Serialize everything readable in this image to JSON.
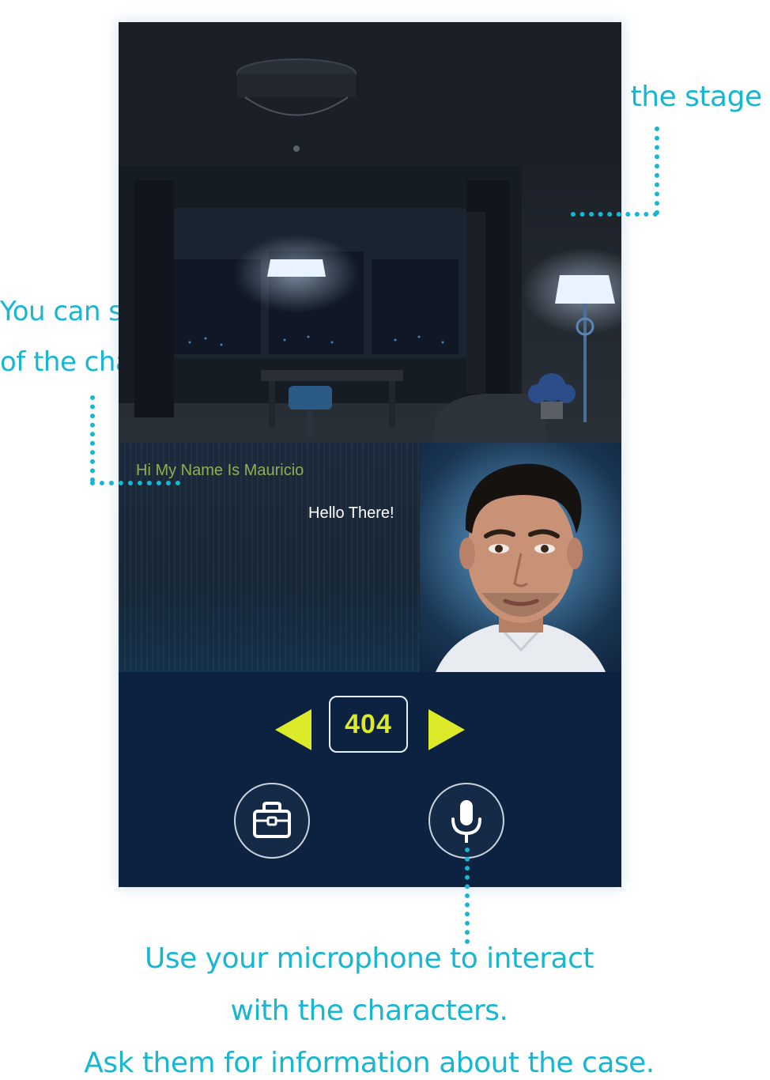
{
  "annotations": {
    "stage": "Pay attention to the stage",
    "answers_line1": "You can see here the answers",
    "answers_line2": "of the characters",
    "mic_line1": "Use your microphone to interact",
    "mic_line2": "with the characters.",
    "mic_line3": "Ask them for information about the case."
  },
  "dialog": {
    "character_line": "Hi My Name Is Mauricio",
    "player_line": "Hello There!"
  },
  "room_nav": {
    "room_number": "404"
  },
  "icons": {
    "prev": "triangle-left-icon",
    "next": "triangle-right-icon",
    "inventory": "briefcase-icon",
    "voice": "microphone-icon"
  },
  "colors": {
    "accent_annotation": "#17b6d1",
    "nav_yellow": "#dcea2a",
    "panel_bg": "#0c2240",
    "character_text": "#8fb04f"
  }
}
